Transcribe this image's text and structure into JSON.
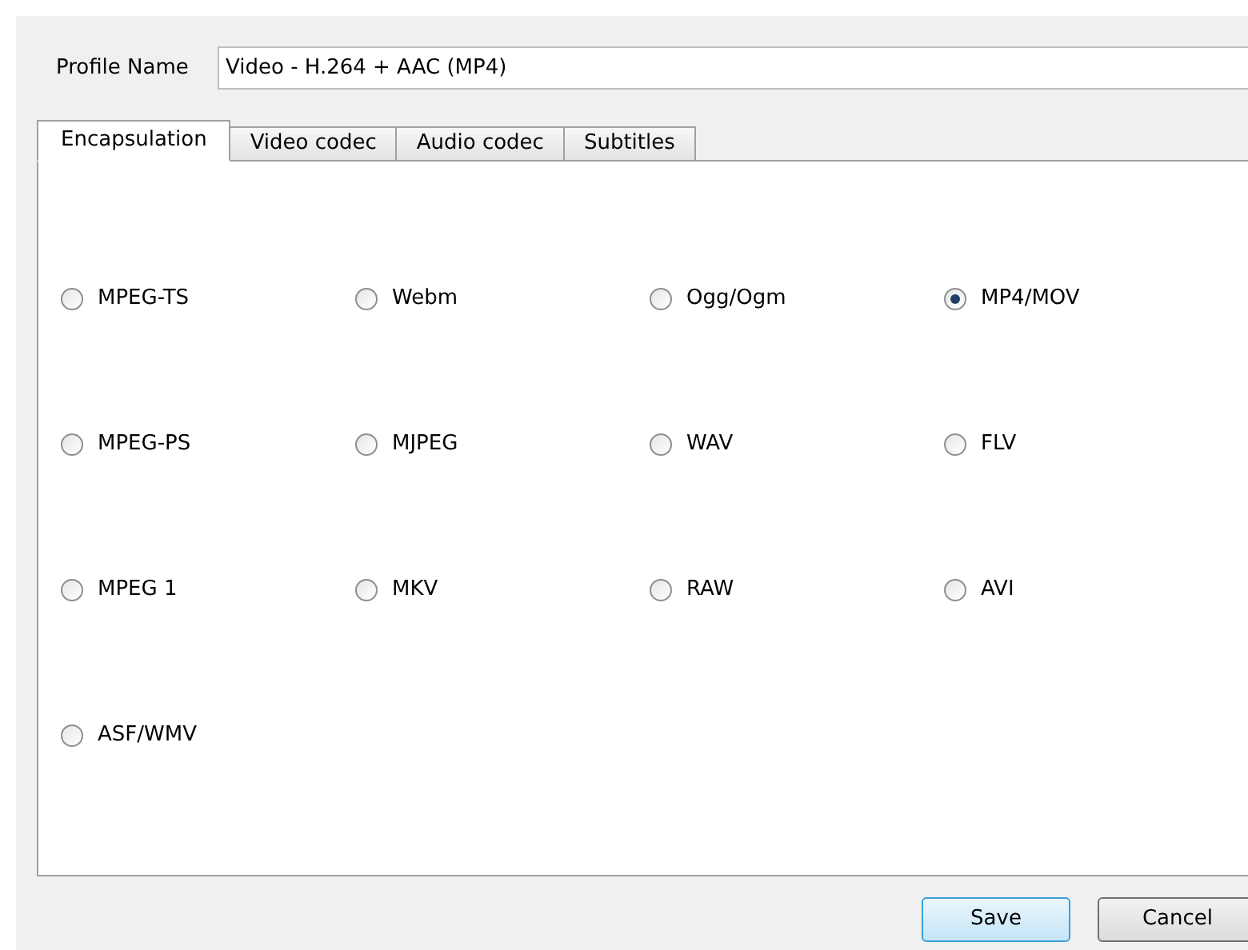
{
  "profile_name": {
    "label": "Profile Name",
    "value": "Video - H.264 + AAC (MP4)"
  },
  "tabs": [
    {
      "label": "Encapsulation",
      "selected": true
    },
    {
      "label": "Video codec",
      "selected": false
    },
    {
      "label": "Audio codec",
      "selected": false
    },
    {
      "label": "Subtitles",
      "selected": false
    }
  ],
  "options": [
    {
      "label": "MPEG-TS",
      "selected": false
    },
    {
      "label": "Webm",
      "selected": false
    },
    {
      "label": "Ogg/Ogm",
      "selected": false
    },
    {
      "label": "MP4/MOV",
      "selected": true
    },
    {
      "label": "MPEG-PS",
      "selected": false
    },
    {
      "label": "MJPEG",
      "selected": false
    },
    {
      "label": "WAV",
      "selected": false
    },
    {
      "label": "FLV",
      "selected": false
    },
    {
      "label": "MPEG 1",
      "selected": false
    },
    {
      "label": "MKV",
      "selected": false
    },
    {
      "label": "RAW",
      "selected": false
    },
    {
      "label": "AVI",
      "selected": false
    },
    {
      "label": "ASF/WMV",
      "selected": false
    }
  ],
  "buttons": [
    {
      "label": "Save",
      "kind": "default"
    },
    {
      "label": "Cancel",
      "kind": "normal"
    }
  ]
}
